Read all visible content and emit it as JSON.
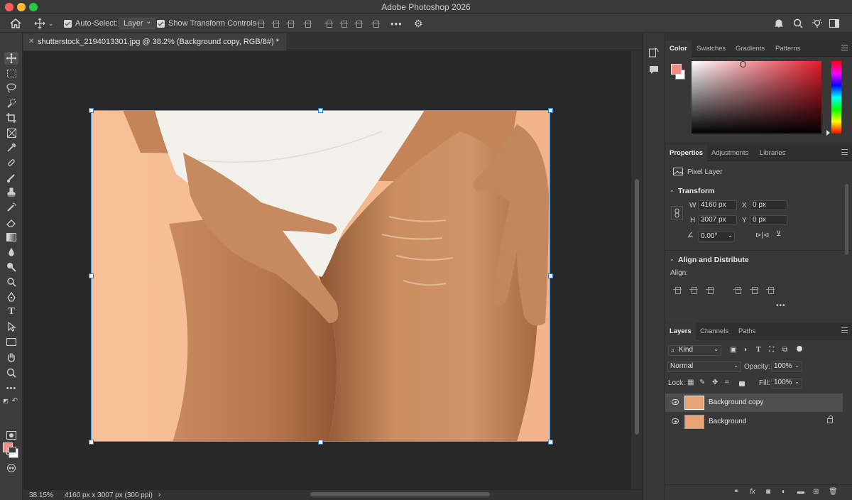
{
  "window": {
    "title": "Adobe Photoshop 2026"
  },
  "options_bar": {
    "auto_select_label": "Auto-Select:",
    "auto_select_value": "Layer",
    "show_transform_label": "Show Transform Controls",
    "more": "•••"
  },
  "document": {
    "tab_title": "shutterstock_2194013301.jpg @ 38.2% (Background copy, RGB/8#) *",
    "zoom": "38.15%",
    "dimensions": "4160 px x 3007 px (300 ppi)",
    "status_arrow": "›"
  },
  "color_panel": {
    "tabs": [
      "Color",
      "Swatches",
      "Gradients",
      "Patterns"
    ],
    "foreground": "#f28b82",
    "background": "#ffffff"
  },
  "properties_panel": {
    "tabs": [
      "Properties",
      "Adjustments",
      "Libraries"
    ],
    "layer_type": "Pixel Layer",
    "transform_heading": "Transform",
    "w_label": "W",
    "w_value": "4160 px",
    "h_label": "H",
    "h_value": "3007 px",
    "x_label": "X",
    "x_value": "0 px",
    "y_label": "Y",
    "y_value": "0 px",
    "angle_value": "0.00°",
    "align_heading": "Align and Distribute",
    "align_label": "Align:",
    "more": "•••"
  },
  "layers_panel": {
    "tabs": [
      "Layers",
      "Channels",
      "Paths"
    ],
    "filter_kind": "Kind",
    "blend_mode": "Normal",
    "opacity_label": "Opacity:",
    "opacity_value": "100%",
    "lock_label": "Lock:",
    "fill_label": "Fill:",
    "fill_value": "100%",
    "layers": [
      {
        "name": "Background copy",
        "selected": true,
        "locked": false
      },
      {
        "name": "Background",
        "selected": false,
        "locked": true
      }
    ]
  },
  "icons": [
    "home-icon",
    "move-icon",
    "bell-icon",
    "search-icon",
    "lightbulb-icon",
    "workspace-icon",
    "gear-icon"
  ]
}
